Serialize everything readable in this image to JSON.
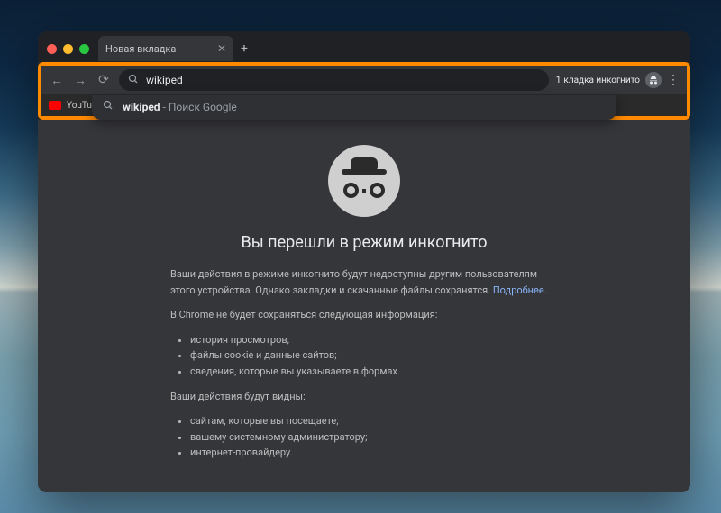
{
  "tab": {
    "title": "Новая вкладка"
  },
  "omnibox": {
    "query": "wikiped"
  },
  "suggestion": {
    "highlighted": "wikiped",
    "rest": " - Поиск Google"
  },
  "bookmarks": {
    "youtube": "YouTub"
  },
  "indicator": {
    "count": "1",
    "label_suffix": "кладка инкогнито"
  },
  "page": {
    "heading": "Вы перешли в режим инкогнито",
    "intro_prefix": "Ваши действия в режиме инкогнито будут недоступны другим пользователям этого устройства. Однако закладки и скачанные файлы сохранятся. ",
    "more_link": "Подробнее..",
    "not_saved_header": "В Chrome не будет сохраняться следующая информация:",
    "not_saved": [
      "история просмотров;",
      "файлы cookie и данные сайтов;",
      "сведения, которые вы указываете в формах."
    ],
    "visible_header": "Ваши действия будут видны:",
    "visible": [
      "сайтам, которые вы посещаете;",
      "вашему системному администратору;",
      "интернет-провайдеру."
    ]
  }
}
